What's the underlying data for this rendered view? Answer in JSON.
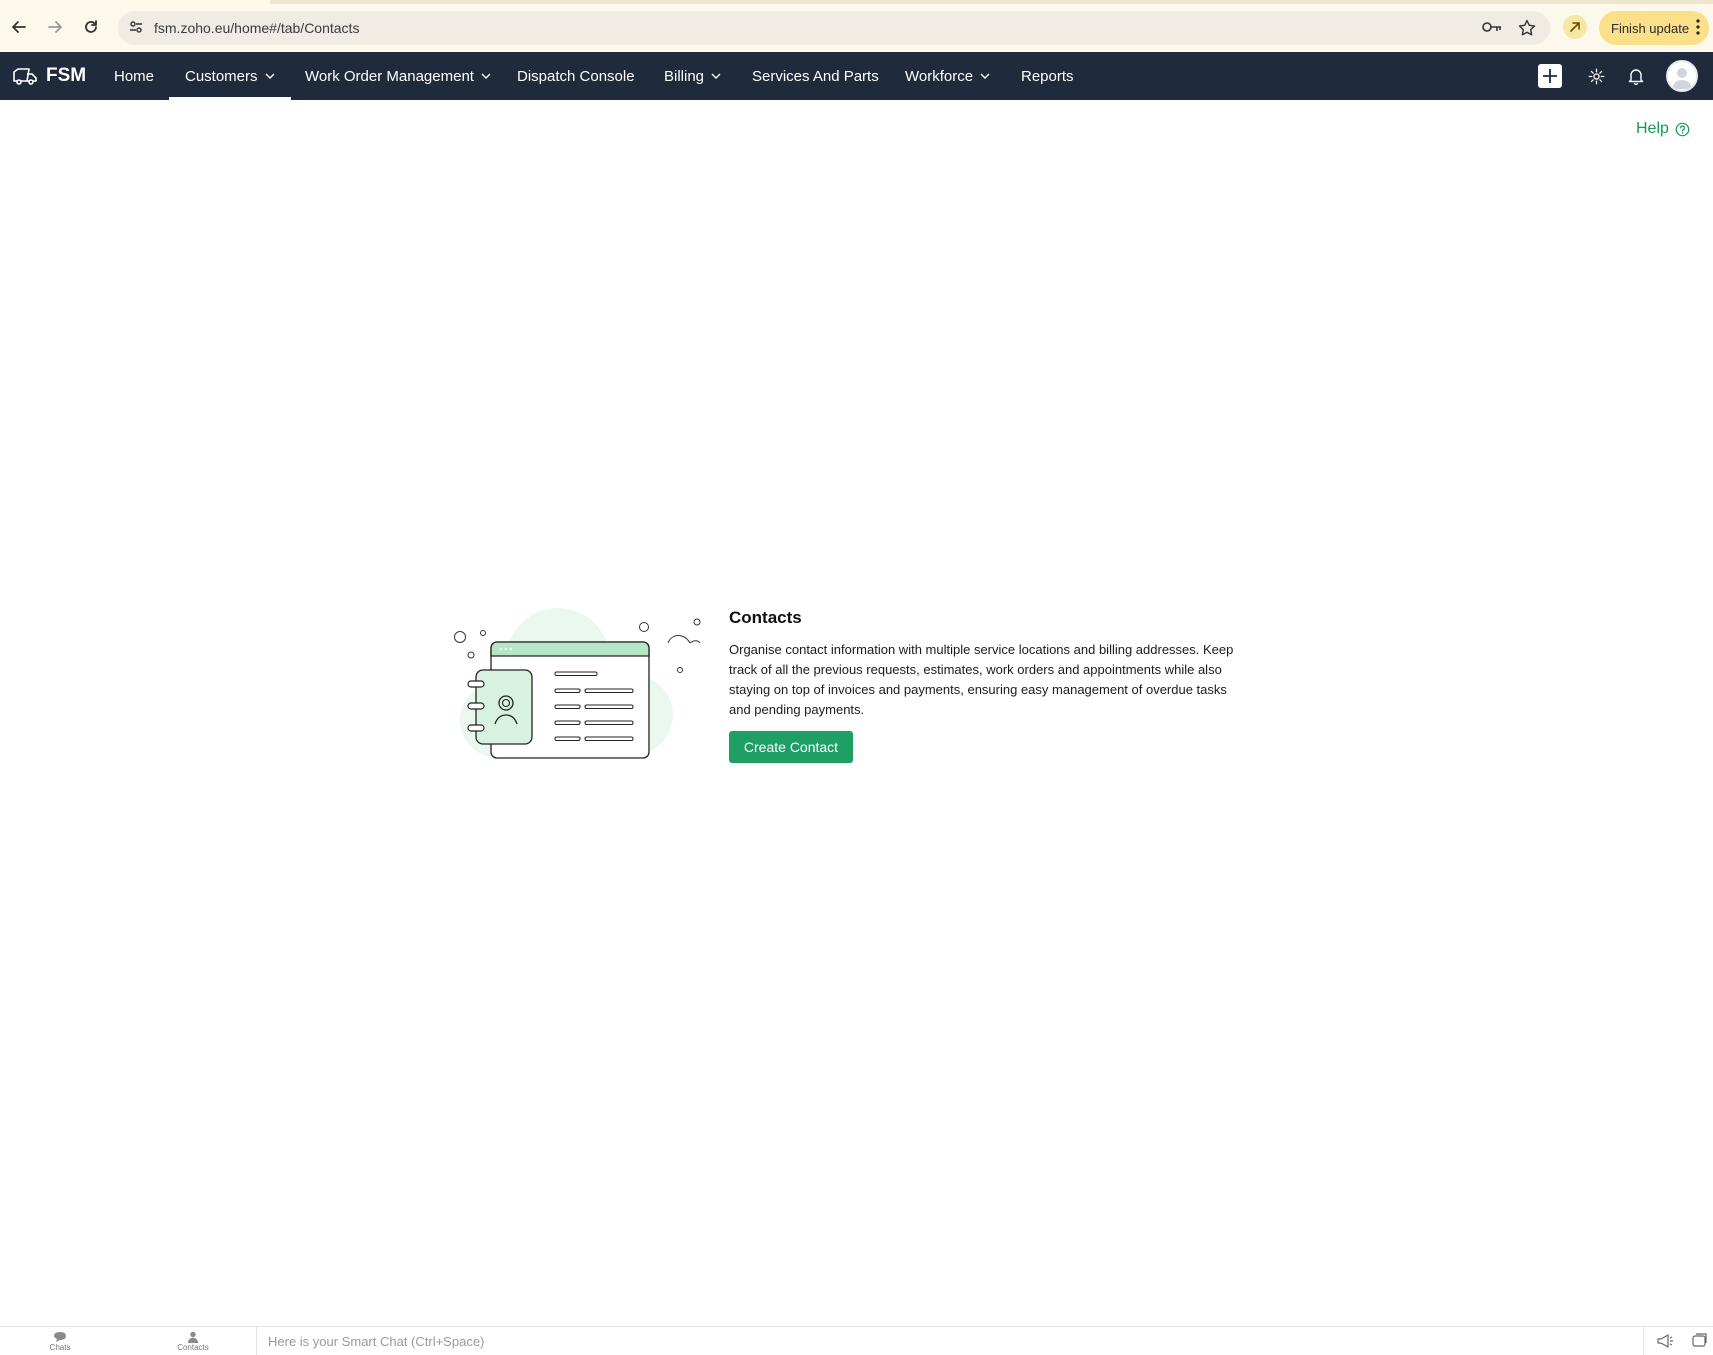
{
  "browser": {
    "url": "fsm.zoho.eu/home#/tab/Contacts",
    "finish_update_label": "Finish update"
  },
  "app": {
    "brand": "FSM",
    "nav": [
      {
        "label": "Home",
        "has_dropdown": false
      },
      {
        "label": "Customers",
        "has_dropdown": true,
        "active": true
      },
      {
        "label": "Work Order Management",
        "has_dropdown": true
      },
      {
        "label": "Dispatch Console",
        "has_dropdown": false
      },
      {
        "label": "Billing",
        "has_dropdown": true
      },
      {
        "label": "Services And Parts",
        "has_dropdown": false
      },
      {
        "label": "Workforce",
        "has_dropdown": true
      },
      {
        "label": "Reports",
        "has_dropdown": false
      }
    ],
    "icons_right": [
      "plus-icon",
      "gear-icon",
      "bell-icon",
      "avatar"
    ]
  },
  "help": {
    "label": "Help"
  },
  "empty_state": {
    "title": "Contacts",
    "description": "Organise contact information with multiple service locations and billing addresses. Keep track of all the previous requests, estimates, work orders and appointments while also staying on top of invoices and payments, ensuring easy management of overdue tasks and pending payments.",
    "button_label": "Create Contact"
  },
  "bottom_bar": {
    "chats_label": "Chats",
    "contacts_label": "Contacts",
    "smartchat_placeholder": "Here is your Smart Chat (Ctrl+Space)"
  },
  "colors": {
    "nav_bg": "#1f2a3c",
    "accent_green": "#1e9f63",
    "help_green": "#159957",
    "update_yellow": "#fbe08a"
  }
}
